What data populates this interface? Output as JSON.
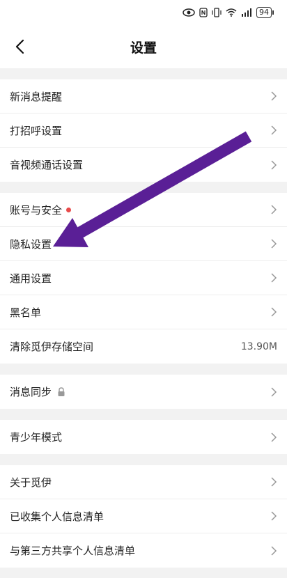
{
  "status_bar": {
    "battery": "94"
  },
  "nav": {
    "title": "设置"
  },
  "groups": {
    "notifications": {
      "new_message": "新消息提醒",
      "greeting": "打招呼设置",
      "av_call": "音视频通话设置"
    },
    "account": {
      "account_security": "账号与安全",
      "privacy": "隐私设置",
      "general": "通用设置",
      "blacklist": "黑名单",
      "clear_storage": "清除觅伊存储空间",
      "storage_size": "13.90M"
    },
    "sync": {
      "message_sync": "消息同步"
    },
    "youth": {
      "youth_mode": "青少年模式"
    },
    "about": {
      "about_app": "关于觅伊",
      "collected_info": "已收集个人信息清单",
      "third_party_info": "与第三方共享个人信息清单"
    }
  },
  "colors": {
    "annotation_arrow": "#5a1f96",
    "badge_red": "#e84a4a"
  }
}
